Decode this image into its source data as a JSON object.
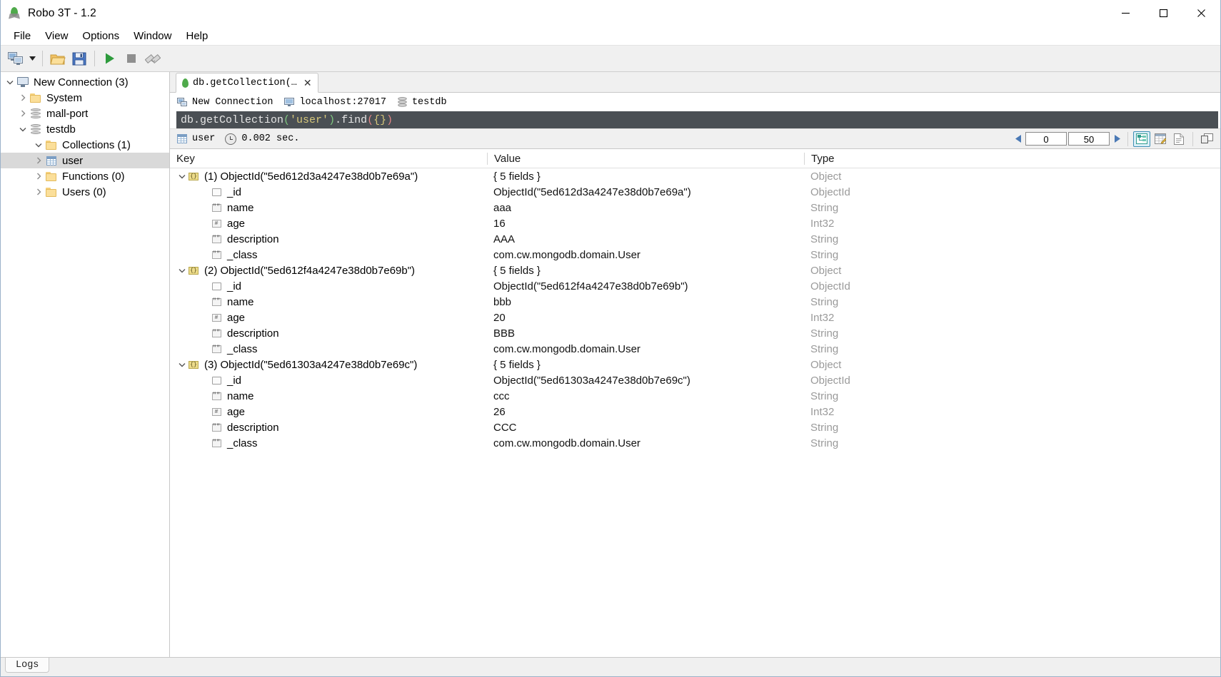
{
  "window": {
    "title": "Robo 3T - 1.2",
    "icon": "leaf-icon",
    "controls": {
      "minimize": "minimize-icon",
      "maximize": "maximize-icon",
      "close": "close-icon"
    }
  },
  "menubar": {
    "items": [
      {
        "label": "File",
        "name": "menu-file"
      },
      {
        "label": "View",
        "name": "menu-view"
      },
      {
        "label": "Options",
        "name": "menu-options"
      },
      {
        "label": "Window",
        "name": "menu-window"
      },
      {
        "label": "Help",
        "name": "menu-help"
      }
    ]
  },
  "toolbar": {
    "items": [
      {
        "name": "connect-button",
        "icon": "computers-icon"
      },
      {
        "name": "connect-dropdown-arrow",
        "icon": "chevron-down-icon"
      },
      {
        "name": "open-script-button",
        "icon": "folder-open-icon"
      },
      {
        "name": "save-script-button",
        "icon": "floppy-disk-icon"
      },
      {
        "name": "execute-button",
        "icon": "play-icon"
      },
      {
        "name": "stop-button",
        "icon": "stop-icon"
      },
      {
        "name": "toggle-orientation-button",
        "icon": "split-view-icon"
      }
    ]
  },
  "sidebar": {
    "tree": [
      {
        "label": "New Connection (3)",
        "icon": "server-icon",
        "depth": 0,
        "expanded": true,
        "selected": false,
        "name": "tree-item-new-connection"
      },
      {
        "label": "System",
        "icon": "folder-icon",
        "depth": 1,
        "expanded": false,
        "selected": false,
        "name": "tree-item-system"
      },
      {
        "label": "mall-port",
        "icon": "database-icon",
        "depth": 1,
        "expanded": false,
        "selected": false,
        "name": "tree-item-mall-port"
      },
      {
        "label": "testdb",
        "icon": "database-icon",
        "depth": 1,
        "expanded": true,
        "selected": false,
        "name": "tree-item-testdb"
      },
      {
        "label": "Collections (1)",
        "icon": "folder-icon",
        "depth": 2,
        "expanded": true,
        "selected": false,
        "name": "tree-item-collections"
      },
      {
        "label": "user",
        "icon": "collection-icon",
        "depth": 3,
        "expanded": false,
        "selected": true,
        "name": "tree-item-user"
      },
      {
        "label": "Functions (0)",
        "icon": "folder-icon",
        "depth": 2,
        "expanded": false,
        "selected": false,
        "name": "tree-item-functions"
      },
      {
        "label": "Users (0)",
        "icon": "folder-icon",
        "depth": 2,
        "expanded": false,
        "selected": false,
        "name": "tree-item-users"
      }
    ]
  },
  "tab": {
    "label": "db.getCollection(…",
    "close_label": "✕"
  },
  "connection_info": {
    "connection": "New Connection",
    "host": "localhost:27017",
    "database": "testdb"
  },
  "editor": {
    "tokens": [
      {
        "text": "db.getCollection",
        "color": "white"
      },
      {
        "text": "(",
        "color": "green"
      },
      {
        "text": "'user'",
        "color": "yellow"
      },
      {
        "text": ")",
        "color": "green"
      },
      {
        "text": ".find",
        "color": "white"
      },
      {
        "text": "(",
        "color": "red"
      },
      {
        "text": "{}",
        "color": "yellow"
      },
      {
        "text": ")",
        "color": "red"
      }
    ],
    "plain": "db.getCollection('user').find({})"
  },
  "result_toolbar": {
    "collection": "user",
    "elapsed": "0.002 sec.",
    "skip_value": "0",
    "limit_value": "50",
    "prev_label": "◀",
    "next_label": "▶",
    "view_modes": [
      {
        "name": "tree-view-button",
        "icon": "tree-view-icon",
        "active": true
      },
      {
        "name": "table-view-button",
        "icon": "table-view-icon",
        "active": false
      },
      {
        "name": "text-view-button",
        "icon": "document-view-icon",
        "active": false
      }
    ],
    "maximize_results": {
      "name": "expand-results-button",
      "icon": "expand-panel-icon"
    }
  },
  "results": {
    "columns": [
      "Key",
      "Value",
      "Type"
    ],
    "rows": [
      {
        "depth": 0,
        "expanded": true,
        "icon": "object-icon",
        "key": "(1) ObjectId(\"5ed612d3a4247e38d0b7e69a\")",
        "value": "{ 5 fields }",
        "type": "Object"
      },
      {
        "depth": 1,
        "expanded": null,
        "icon": "objectid-icon",
        "key": "_id",
        "value": "ObjectId(\"5ed612d3a4247e38d0b7e69a\")",
        "type": "ObjectId"
      },
      {
        "depth": 1,
        "expanded": null,
        "icon": "string-icon",
        "key": "name",
        "value": "aaa",
        "type": "String"
      },
      {
        "depth": 1,
        "expanded": null,
        "icon": "int-icon",
        "key": "age",
        "value": "16",
        "type": "Int32"
      },
      {
        "depth": 1,
        "expanded": null,
        "icon": "string-icon",
        "key": "description",
        "value": "AAA",
        "type": "String"
      },
      {
        "depth": 1,
        "expanded": null,
        "icon": "string-icon",
        "key": "_class",
        "value": "com.cw.mongodb.domain.User",
        "type": "String"
      },
      {
        "depth": 0,
        "expanded": true,
        "icon": "object-icon",
        "key": "(2) ObjectId(\"5ed612f4a4247e38d0b7e69b\")",
        "value": "{ 5 fields }",
        "type": "Object"
      },
      {
        "depth": 1,
        "expanded": null,
        "icon": "objectid-icon",
        "key": "_id",
        "value": "ObjectId(\"5ed612f4a4247e38d0b7e69b\")",
        "type": "ObjectId"
      },
      {
        "depth": 1,
        "expanded": null,
        "icon": "string-icon",
        "key": "name",
        "value": "bbb",
        "type": "String"
      },
      {
        "depth": 1,
        "expanded": null,
        "icon": "int-icon",
        "key": "age",
        "value": "20",
        "type": "Int32"
      },
      {
        "depth": 1,
        "expanded": null,
        "icon": "string-icon",
        "key": "description",
        "value": "BBB",
        "type": "String"
      },
      {
        "depth": 1,
        "expanded": null,
        "icon": "string-icon",
        "key": "_class",
        "value": "com.cw.mongodb.domain.User",
        "type": "String"
      },
      {
        "depth": 0,
        "expanded": true,
        "icon": "object-icon",
        "key": "(3) ObjectId(\"5ed61303a4247e38d0b7e69c\")",
        "value": "{ 5 fields }",
        "type": "Object"
      },
      {
        "depth": 1,
        "expanded": null,
        "icon": "objectid-icon",
        "key": "_id",
        "value": "ObjectId(\"5ed61303a4247e38d0b7e69c\")",
        "type": "ObjectId"
      },
      {
        "depth": 1,
        "expanded": null,
        "icon": "string-icon",
        "key": "name",
        "value": "ccc",
        "type": "String"
      },
      {
        "depth": 1,
        "expanded": null,
        "icon": "int-icon",
        "key": "age",
        "value": "26",
        "type": "Int32"
      },
      {
        "depth": 1,
        "expanded": null,
        "icon": "string-icon",
        "key": "description",
        "value": "CCC",
        "type": "String"
      },
      {
        "depth": 1,
        "expanded": null,
        "icon": "string-icon",
        "key": "_class",
        "value": "com.cw.mongodb.domain.User",
        "type": "String"
      }
    ]
  },
  "statusbar": {
    "logs_label": "Logs"
  },
  "colors": {
    "accent_blue": "#3e8fb5",
    "selection_grey": "#d9d9d9",
    "editor_bg": "#4a4f54",
    "toolbar_bg": "#f0f0f0",
    "type_text": "#9a9a9a",
    "leaf_green": "#4faa4b"
  }
}
